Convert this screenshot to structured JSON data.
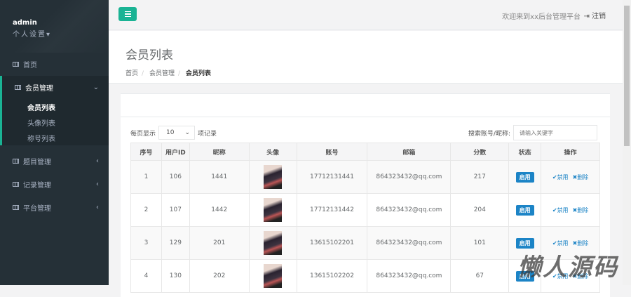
{
  "sidebar": {
    "user": "admin",
    "settings": "个人设置▾",
    "home": "首页",
    "member_group": "会员管理",
    "sub_items": [
      "会员列表",
      "头像列表",
      "称号列表"
    ],
    "others": [
      "题目管理",
      "记录管理",
      "平台管理"
    ]
  },
  "topbar": {
    "welcome": "欢迎来到xx后台管理平台",
    "logout": "⇥ 注销"
  },
  "heading": {
    "title": "会员列表",
    "crumbs": [
      "首页",
      "会员管理",
      "会员列表"
    ]
  },
  "controls": {
    "per_page_prefix": "每页显示",
    "per_page": "10",
    "per_page_suffix": "项记录",
    "search_label": "搜索账号/昵称:",
    "search_placeholder": "请输入关键字"
  },
  "table": {
    "headers": [
      "序号",
      "用户ID",
      "昵称",
      "头像",
      "账号",
      "邮箱",
      "分数",
      "状态",
      "操作"
    ],
    "rows": [
      {
        "no": "1",
        "uid": "106",
        "nick": "1441",
        "account": "17712131441",
        "email": "864323432@qq.com",
        "score": "217",
        "status": "启用"
      },
      {
        "no": "2",
        "uid": "107",
        "nick": "1442",
        "account": "17712131442",
        "email": "864323432@qq.com",
        "score": "204",
        "status": "启用"
      },
      {
        "no": "3",
        "uid": "129",
        "nick": "201",
        "account": "13615102201",
        "email": "864323432@qq.com",
        "score": "101",
        "status": "启用"
      },
      {
        "no": "4",
        "uid": "130",
        "nick": "202",
        "account": "13615102202",
        "email": "864323432@qq.com",
        "score": "67",
        "status": "启用"
      }
    ],
    "disable_label": "✔禁用",
    "delete_label": "✖删除"
  },
  "watermark": "懒人源码"
}
